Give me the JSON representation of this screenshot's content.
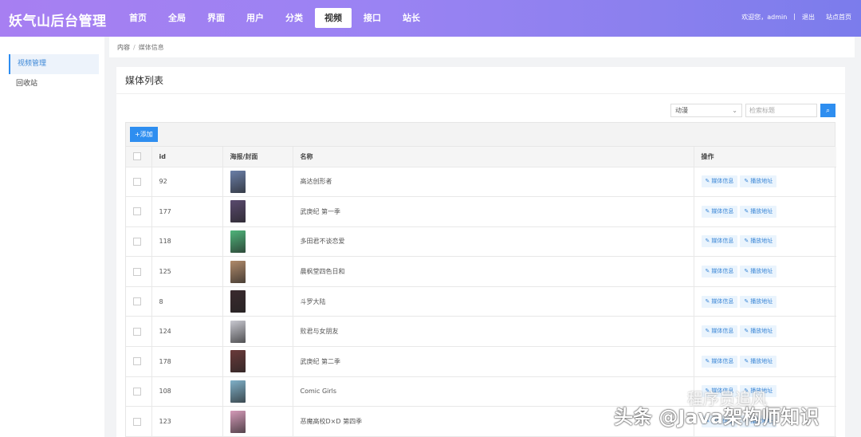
{
  "header": {
    "brand": "妖气山后台管理",
    "nav": [
      {
        "label": "首页",
        "active": false
      },
      {
        "label": "全局",
        "active": false
      },
      {
        "label": "界面",
        "active": false
      },
      {
        "label": "用户",
        "active": false
      },
      {
        "label": "分类",
        "active": false
      },
      {
        "label": "视频",
        "active": true
      },
      {
        "label": "接口",
        "active": false
      },
      {
        "label": "站长",
        "active": false
      }
    ],
    "welcome": "欢迎您，admin",
    "divider": "|",
    "logout": "退出",
    "site_home": "站点首页"
  },
  "sidebar": {
    "items": [
      {
        "label": "视频管理",
        "active": true
      },
      {
        "label": "回收站",
        "active": false
      }
    ]
  },
  "breadcrumb": {
    "root": "内容",
    "sep": "/",
    "current": "媒体信息"
  },
  "card": {
    "title": "媒体列表"
  },
  "toolbar": {
    "category_selected": "动漫",
    "search_placeholder": "检索标题",
    "search_icon": "search-icon"
  },
  "add_button": {
    "icon": "+",
    "label": "添加"
  },
  "table": {
    "headers": [
      "id",
      "海报/封面",
      "名称",
      "操作"
    ],
    "op_labels": [
      "媒体信息",
      "播放地址"
    ],
    "rows": [
      {
        "id": "92",
        "title": "高达创形者",
        "poster_color": "#6b7fa8"
      },
      {
        "id": "177",
        "title": "武庚纪 第一季",
        "poster_color": "#5a4a6e"
      },
      {
        "id": "118",
        "title": "多田君不谈恋爱",
        "poster_color": "#4fb47a"
      },
      {
        "id": "125",
        "title": "晨枫堂四色日和",
        "poster_color": "#b08a6a"
      },
      {
        "id": "8",
        "title": "斗罗大陆",
        "poster_color": "#3a2a2e"
      },
      {
        "id": "124",
        "title": "败君与女朋友",
        "poster_color": "#c8c8d0"
      },
      {
        "id": "178",
        "title": "武庚纪 第二季",
        "poster_color": "#6a3a3a"
      },
      {
        "id": "108",
        "title": "Comic Girls",
        "poster_color": "#7fb0c8"
      },
      {
        "id": "123",
        "title": "恶魔高校D×D 第四季",
        "poster_color": "#d49ab8"
      }
    ]
  },
  "watermark": {
    "text": "头条 @Java架构师知识",
    "text2": "程序员追风"
  }
}
